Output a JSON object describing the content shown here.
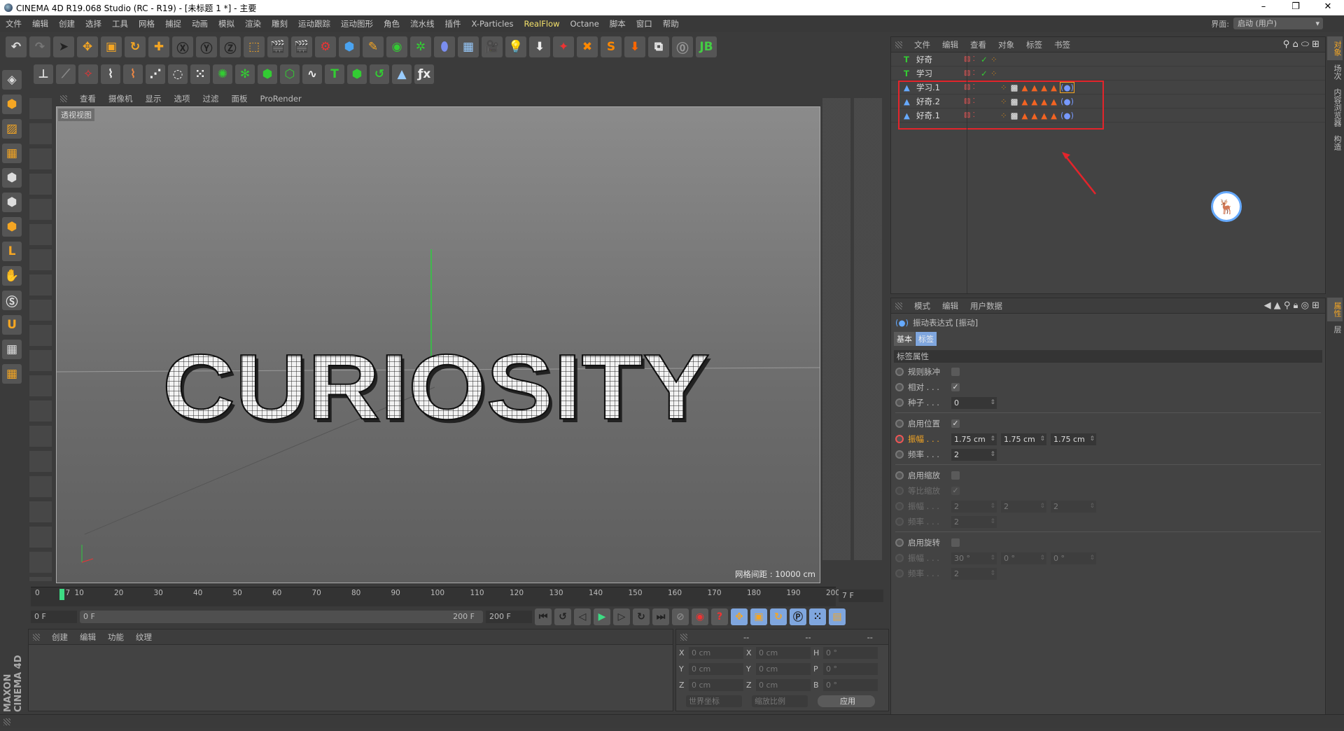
{
  "window": {
    "title": "CINEMA 4D R19.068 Studio (RC - R19) - [未标题 1 *] - 主要",
    "controls": [
      "–",
      "❐",
      "✕"
    ]
  },
  "menu": [
    "文件",
    "编辑",
    "创建",
    "选择",
    "工具",
    "网格",
    "捕捉",
    "动画",
    "模拟",
    "渲染",
    "雕刻",
    "运动跟踪",
    "运动图形",
    "角色",
    "流水线",
    "插件",
    "X-Particles",
    "RealFlow",
    "Octane",
    "脚本",
    "窗口",
    "帮助"
  ],
  "menu_highlight": "RealFlow",
  "layout": {
    "label": "界面:",
    "value": "启动 (用户)"
  },
  "toolbar_row1": [
    {
      "name": "undo",
      "g": "↶",
      "c": "#ddd"
    },
    {
      "name": "redo",
      "g": "↷",
      "c": "#777"
    },
    {
      "name": "live-select",
      "g": "➤",
      "c": "#222"
    },
    {
      "name": "move",
      "g": "✥",
      "c": "#f5a623"
    },
    {
      "name": "scale",
      "g": "▣",
      "c": "#f5a623"
    },
    {
      "name": "rotate",
      "g": "↻",
      "c": "#f5a623"
    },
    {
      "name": "recent-tool",
      "g": "✚",
      "c": "#f5a623"
    },
    {
      "name": "x-axis",
      "g": "Ⓧ",
      "c": "#222"
    },
    {
      "name": "y-axis",
      "g": "Ⓨ",
      "c": "#222"
    },
    {
      "name": "z-axis",
      "g": "Ⓩ",
      "c": "#222"
    },
    {
      "name": "coordinate-system",
      "g": "⬚",
      "c": "#f5a623"
    },
    {
      "name": "render-view",
      "g": "🎬",
      "c": "#222"
    },
    {
      "name": "render-picture-viewer",
      "g": "🎬",
      "c": "#e33"
    },
    {
      "name": "render-settings",
      "g": "⚙",
      "c": "#e33"
    },
    {
      "name": "cube",
      "g": "⬢",
      "c": "#4aa3f0"
    },
    {
      "name": "pen",
      "g": "✎",
      "c": "#f5a623"
    },
    {
      "name": "subdivision",
      "g": "◉",
      "c": "#3c3"
    },
    {
      "name": "cloner",
      "g": "✲",
      "c": "#3c3"
    },
    {
      "name": "deformer",
      "g": "⬮",
      "c": "#7a8ef0"
    },
    {
      "name": "floor",
      "g": "▦",
      "c": "#9cf"
    },
    {
      "name": "camera",
      "g": "🎥",
      "c": "#222"
    },
    {
      "name": "light",
      "g": "💡",
      "c": "#ddd"
    },
    {
      "name": "drop-to-floor",
      "g": "⬇",
      "c": "#eee"
    },
    {
      "name": "plugin-a",
      "g": "✦",
      "c": "#e33"
    },
    {
      "name": "plugin-b",
      "g": "✖",
      "c": "#f80"
    },
    {
      "name": "plugin-s",
      "g": "S",
      "c": "#f80"
    },
    {
      "name": "plugin-drop",
      "g": "⬇",
      "c": "#f60"
    },
    {
      "name": "plugin-c",
      "g": "⧉",
      "c": "#eee"
    },
    {
      "name": "psr",
      "g": "⓪",
      "c": "#999"
    },
    {
      "name": "plugin-jb",
      "g": "JB",
      "c": "#4c4"
    }
  ],
  "toolbar_row2": [
    {
      "name": "workplane",
      "g": "⊥",
      "c": "#ddd"
    },
    {
      "name": "knife",
      "g": "⟋",
      "c": "#888"
    },
    {
      "name": "magnet",
      "g": "✧",
      "c": "#e33"
    },
    {
      "name": "spline-pen",
      "g": "⌇",
      "c": "#eee"
    },
    {
      "name": "spline-sketch",
      "g": "⌇",
      "c": "#e84"
    },
    {
      "name": "spline-smooth",
      "g": "⋰",
      "c": "#eee"
    },
    {
      "name": "circle",
      "g": "◌",
      "c": "#eee"
    },
    {
      "name": "grid-array",
      "g": "⁙",
      "c": "#eee"
    },
    {
      "name": "mograph-a",
      "g": "✺",
      "c": "#3c3"
    },
    {
      "name": "mograph-b",
      "g": "✻",
      "c": "#3c3"
    },
    {
      "name": "mograph-c",
      "g": "⬢",
      "c": "#3c3"
    },
    {
      "name": "mograph-d",
      "g": "⬡",
      "c": "#3c3"
    },
    {
      "name": "tracer",
      "g": "∿",
      "c": "#eee"
    },
    {
      "name": "text",
      "g": "T",
      "c": "#3c3"
    },
    {
      "name": "extrude",
      "g": "⬢",
      "c": "#3c3"
    },
    {
      "name": "spline-wrap",
      "g": "↺",
      "c": "#3c3"
    },
    {
      "name": "sculpt",
      "g": "▲",
      "c": "#9cf"
    },
    {
      "name": "fx",
      "g": "ƒx",
      "c": "#eee"
    }
  ],
  "left_tools": [
    {
      "name": "model-mode",
      "g": "◈",
      "c": "#ddd"
    },
    {
      "name": "object-mode",
      "g": "⬢",
      "c": "#f5a623"
    },
    {
      "name": "texture-mode",
      "g": "▨",
      "c": "#f5a623"
    },
    {
      "name": "workplane-mode",
      "g": "▦",
      "c": "#f5a623"
    },
    {
      "name": "points-mode",
      "g": "⬢",
      "c": "#ddd"
    },
    {
      "name": "edges-mode",
      "g": "⬢",
      "c": "#ddd"
    },
    {
      "name": "polygons-mode",
      "g": "⬢",
      "c": "#f5a623"
    },
    {
      "name": "axis-mode",
      "g": "L",
      "c": "#f5a623"
    },
    {
      "name": "tweak-mode",
      "g": "✋",
      "c": "#f5a623"
    },
    {
      "name": "snap",
      "g": "Ⓢ",
      "c": "#ddd"
    },
    {
      "name": "magnet-snap",
      "g": "U",
      "c": "#f5a623"
    },
    {
      "name": "lock-workplane",
      "g": "▦",
      "c": "#ddd"
    },
    {
      "name": "locked-grid",
      "g": "▦",
      "c": "#f5a623"
    }
  ],
  "viewport": {
    "menu": [
      "查看",
      "摄像机",
      "显示",
      "选项",
      "过滤",
      "面板",
      "ProRender"
    ],
    "label": "透视视图",
    "grid_spacing": "网格间距 : 10000 cm",
    "text": "CURIOSITY"
  },
  "objects": {
    "menu": [
      "文件",
      "编辑",
      "查看",
      "对象",
      "标签",
      "书签"
    ],
    "rows": [
      {
        "name": "好奇",
        "type": "text",
        "tags": [
          "phong"
        ]
      },
      {
        "name": "学习",
        "type": "text",
        "tags": [
          "phong"
        ]
      },
      {
        "name": "学习.1",
        "type": "spline",
        "tags": [
          "phong",
          "texture",
          "sel",
          "sel",
          "sel",
          "sel",
          "vibrate-active"
        ]
      },
      {
        "name": "好奇.2",
        "type": "spline",
        "tags": [
          "phong",
          "texture",
          "sel",
          "sel",
          "sel",
          "sel",
          "vibrate"
        ]
      },
      {
        "name": "好奇.1",
        "type": "spline",
        "tags": [
          "phong",
          "texture",
          "sel",
          "sel",
          "sel",
          "sel",
          "vibrate"
        ]
      }
    ]
  },
  "right_tabs_top": [
    "对象",
    "场次",
    "内容浏览器",
    "构造"
  ],
  "right_tabs_bottom": [
    "属性",
    "层"
  ],
  "attributes": {
    "menu": [
      "模式",
      "编辑",
      "用户数据"
    ],
    "title": "振动表达式 [振动]",
    "tabs": [
      "基本",
      "标签"
    ],
    "active_tab": "标签",
    "section": "标签属性",
    "rows": [
      {
        "label": "规则脉冲",
        "type": "check",
        "checked": false
      },
      {
        "label": "相对 . . .",
        "type": "check",
        "checked": true
      },
      {
        "label": "种子 . . .",
        "type": "fields",
        "values": [
          "0"
        ]
      },
      {
        "sep": true
      },
      {
        "label": "启用位置",
        "type": "check",
        "checked": true
      },
      {
        "label": "振幅 . . .",
        "type": "fields",
        "values": [
          "1.75 cm",
          "1.75 cm",
          "1.75 cm"
        ],
        "active": true
      },
      {
        "label": "频率 . . .",
        "type": "fields",
        "values": [
          "2"
        ]
      },
      {
        "sep": true
      },
      {
        "label": "启用缩放",
        "type": "check",
        "checked": false
      },
      {
        "label": "等比缩放",
        "type": "check",
        "checked": true,
        "dim": true
      },
      {
        "label": "振幅 . . .",
        "type": "fields",
        "values": [
          "2",
          "2",
          "2"
        ],
        "dim": true
      },
      {
        "label": "频率 . . .",
        "type": "fields",
        "values": [
          "2"
        ],
        "dim": true
      },
      {
        "sep": true
      },
      {
        "label": "启用旋转",
        "type": "check",
        "checked": false
      },
      {
        "label": "振幅 . . .",
        "type": "fields",
        "values": [
          "30 °",
          "0 °",
          "0 °"
        ],
        "dim": true
      },
      {
        "label": "频率 . . .",
        "type": "fields",
        "values": [
          "2"
        ],
        "dim": true
      }
    ]
  },
  "timeline": {
    "ticks": [
      "0",
      "7",
      "10",
      "20",
      "30",
      "40",
      "50",
      "60",
      "70",
      "80",
      "90",
      "100",
      "110",
      "120",
      "130",
      "140",
      "150",
      "160",
      "170",
      "180",
      "190",
      "200"
    ],
    "current_frame": 7,
    "max": 200,
    "current_label": "7 F"
  },
  "playback": {
    "start": "0 F",
    "range_start": "0 F",
    "range_end": "200 F",
    "end": "200 F"
  },
  "materials": {
    "menu": [
      "创建",
      "编辑",
      "功能",
      "纹理"
    ],
    "logo": "MAXON CINEMA 4D"
  },
  "coords": {
    "headers": [
      "--",
      "--",
      "--"
    ],
    "rows": [
      {
        "a": "X",
        "av": "0 cm",
        "b": "X",
        "bv": "0 cm",
        "c": "H",
        "cv": "0 °"
      },
      {
        "a": "Y",
        "av": "0 cm",
        "b": "Y",
        "bv": "0 cm",
        "c": "P",
        "cv": "0 °"
      },
      {
        "a": "Z",
        "av": "0 cm",
        "b": "Z",
        "bv": "0 cm",
        "c": "B",
        "cv": "0 °"
      }
    ],
    "mode": "世界坐标",
    "scale": "缩放比例",
    "apply": "应用"
  },
  "colors": {
    "accent": "#f5a623",
    "highlight_box": "#e3242b",
    "axis_y": "#2ecc40",
    "timeline_marker": "#3ddc84"
  }
}
